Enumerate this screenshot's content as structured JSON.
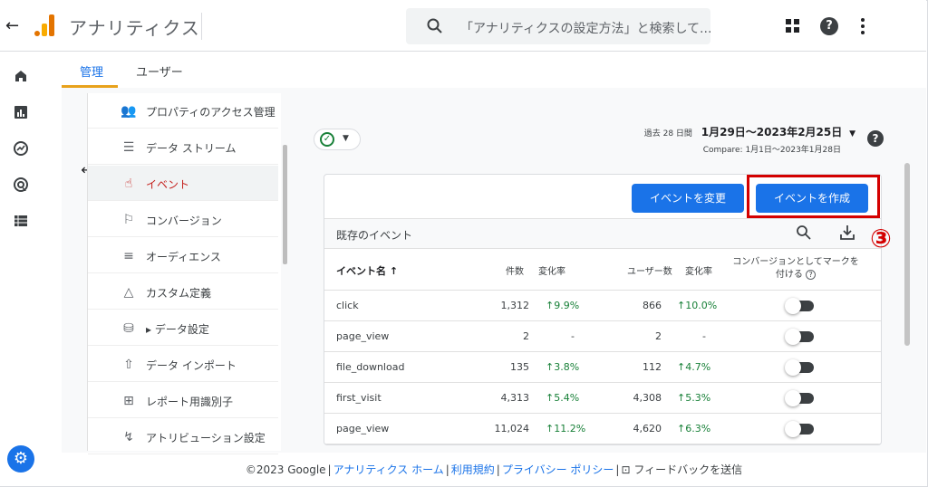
{
  "app": {
    "title": "アナリティクス",
    "search_placeholder": "「アナリティクスの設定方法」と検索して..."
  },
  "tabs": [
    {
      "label": "管理",
      "active": true
    },
    {
      "label": "ユーザー",
      "active": false
    }
  ],
  "nav": {
    "items": [
      {
        "label": "プロパティのアクセス管理",
        "icon": "people-icon",
        "active": false
      },
      {
        "label": "データ ストリーム",
        "icon": "streams-icon",
        "active": false
      },
      {
        "label": "イベント",
        "icon": "touch-icon",
        "active": true
      },
      {
        "label": "コンバージョン",
        "icon": "flag-icon",
        "active": false
      },
      {
        "label": "オーディエンス",
        "icon": "audience-icon",
        "active": false
      },
      {
        "label": "カスタム定義",
        "icon": "shapes-icon",
        "active": false
      },
      {
        "label": "▸ データ設定",
        "icon": "database-icon",
        "active": false
      },
      {
        "label": "データ インポート",
        "icon": "upload-icon",
        "active": false
      },
      {
        "label": "レポート用識別子",
        "icon": "identifier-icon",
        "active": false
      },
      {
        "label": "アトリビューション設定",
        "icon": "attribution-icon",
        "active": false
      }
    ]
  },
  "date": {
    "range_prefix": "過去 28 日間",
    "range": "1月29日～2023年2月25日",
    "compare": "Compare: 1月1日～2023年1月28日"
  },
  "buttons": {
    "modify": "イベントを変更",
    "create": "イベントを作成"
  },
  "step_badge": "③",
  "table": {
    "title": "既存のイベント",
    "headers": {
      "name": "イベント名 ↑",
      "count": "件数",
      "count_change": "変化率",
      "users": "ユーザー数",
      "users_change": "変化率",
      "conversion_line1": "コンバージョンとしてマークを",
      "conversion_line2": "付ける"
    },
    "rows": [
      {
        "name": "click",
        "count": "1,312",
        "count_change": "↑9.9%",
        "users": "866",
        "users_change": "↑10.0%",
        "conversion": false
      },
      {
        "name": "page_view",
        "count": "2",
        "count_change": "-",
        "users": "2",
        "users_change": "-",
        "conversion": false
      },
      {
        "name": "file_download",
        "count": "135",
        "count_change": "↑3.8%",
        "users": "112",
        "users_change": "↑4.7%",
        "conversion": false
      },
      {
        "name": "first_visit",
        "count": "4,313",
        "count_change": "↑5.4%",
        "users": "4,308",
        "users_change": "↑5.3%",
        "conversion": false
      },
      {
        "name": "page_view",
        "count": "11,024",
        "count_change": "↑11.2%",
        "users": "4,620",
        "users_change": "↑6.3%",
        "conversion": false
      }
    ]
  },
  "footer": {
    "copyright": "©2023 Google",
    "links": [
      "アナリティクス ホーム",
      "利用規約",
      "プライバシー ポリシー"
    ],
    "feedback": "フィードバックを送信"
  },
  "colors": {
    "accent": "#1a73e8",
    "highlight": "#d40000",
    "positive": "#188038",
    "tab_underline": "#e8a21b"
  }
}
